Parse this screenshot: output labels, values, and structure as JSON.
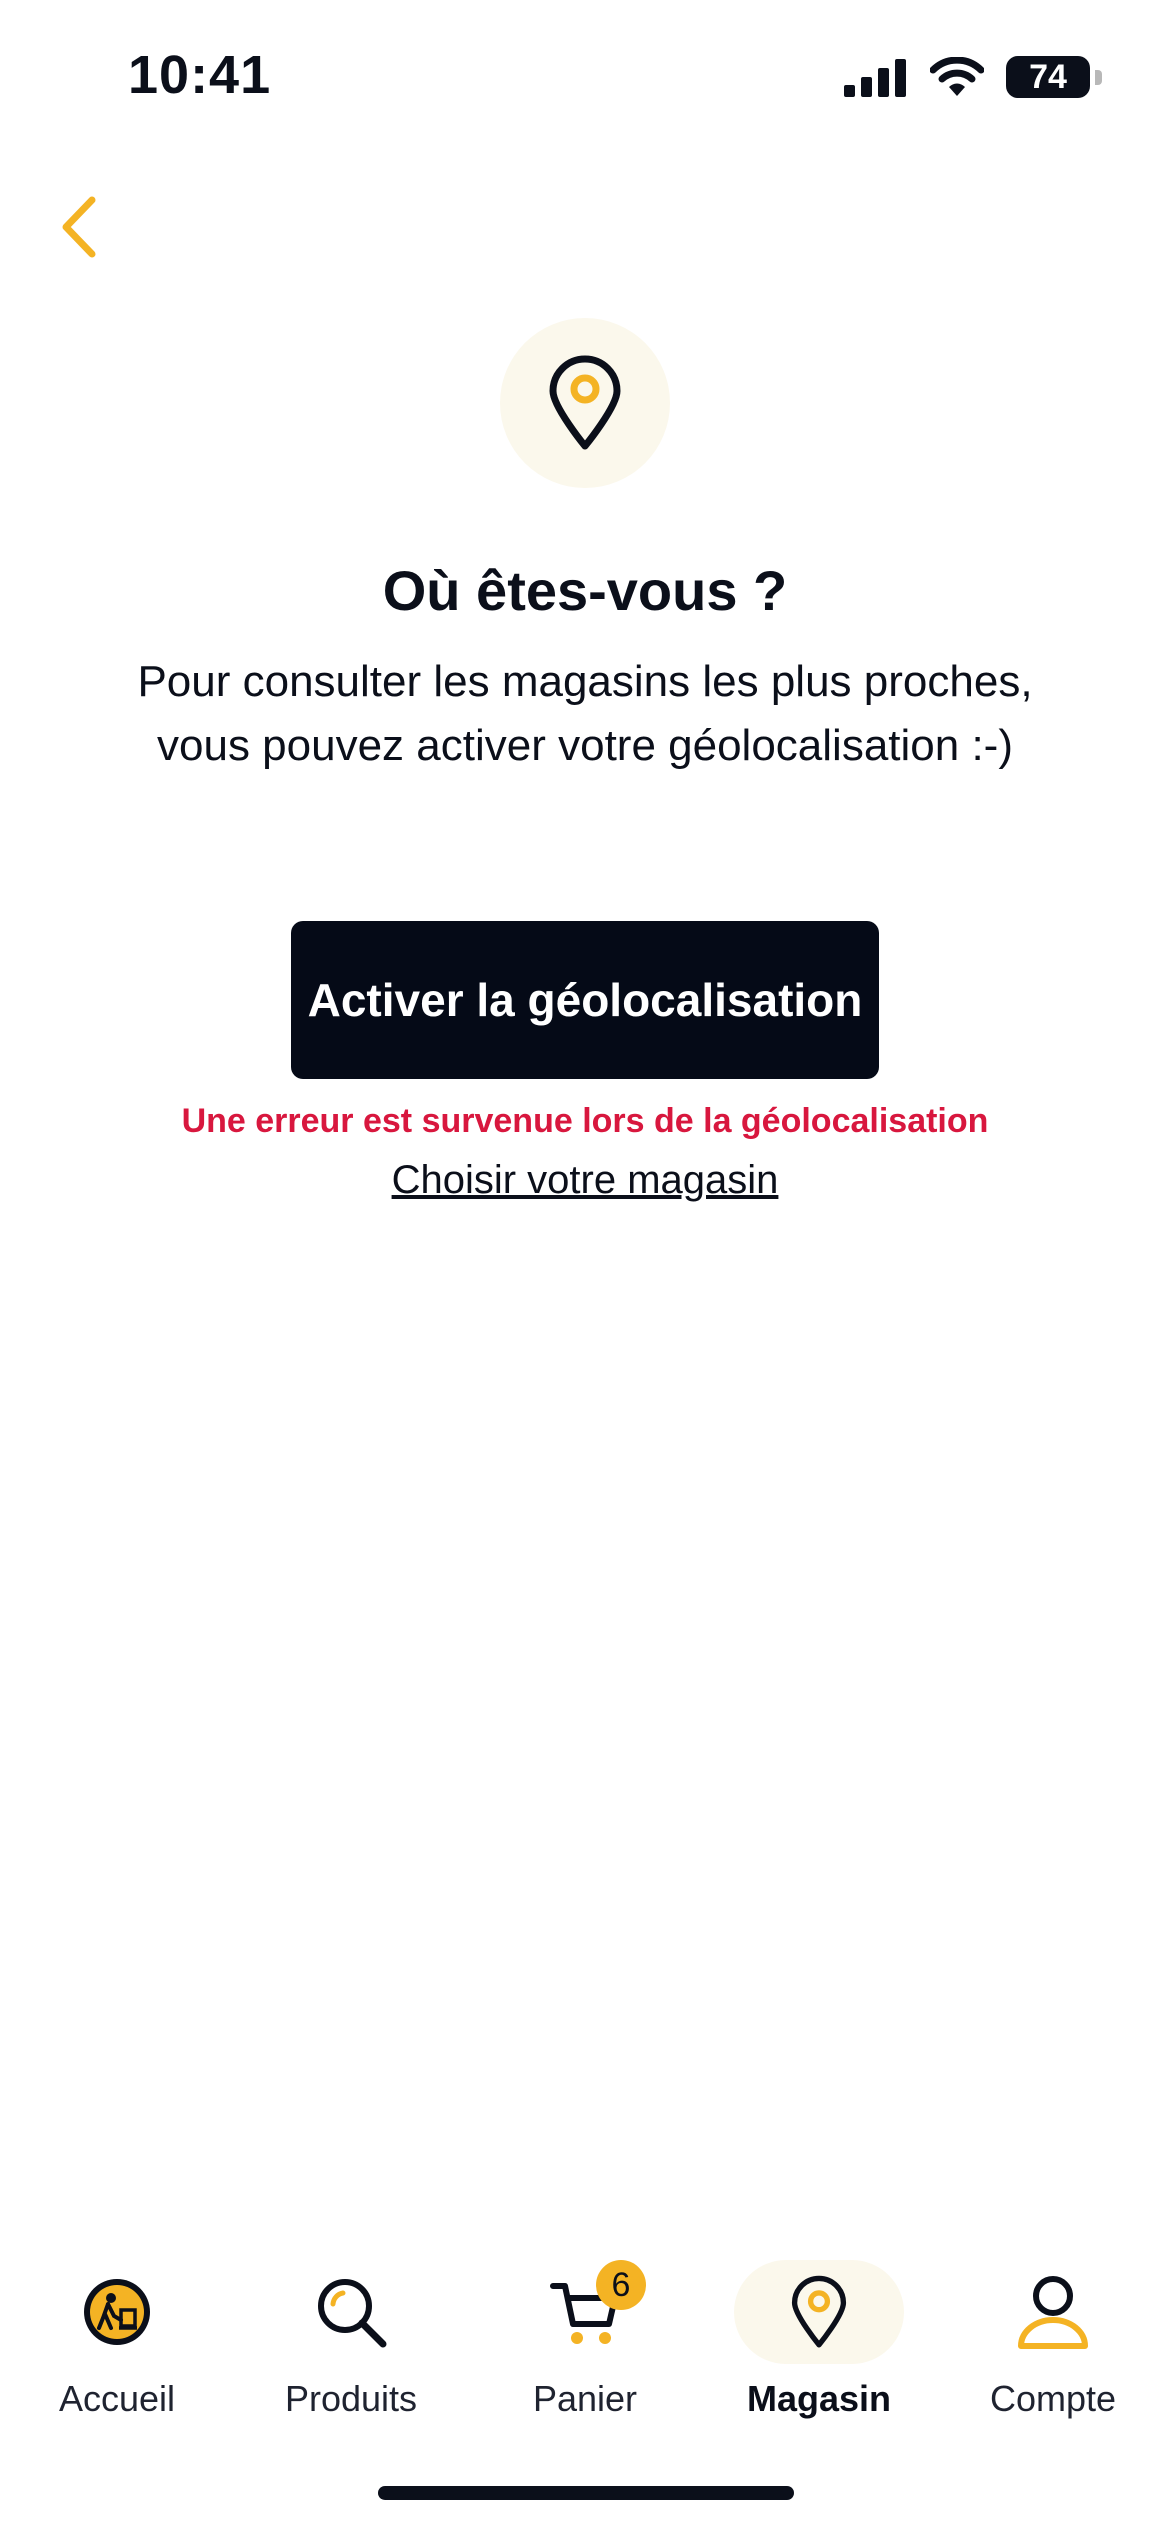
{
  "status_bar": {
    "time": "10:41",
    "battery": "74",
    "icons": [
      "cellular-signal-icon",
      "wifi-icon",
      "battery-icon"
    ]
  },
  "header": {
    "back_icon": "chevron-left-icon"
  },
  "hero": {
    "icon": "location-pin-icon"
  },
  "content": {
    "title": "Où êtes-vous ?",
    "subtitle_line1": "Pour consulter les magasins les plus proches,",
    "subtitle_line2": "vous pouvez activer votre géolocalisation :-)",
    "primary_button": "Activer la géolocalisation",
    "error_message": "Une erreur est survenue lors de la géolocalisation",
    "secondary_link": "Choisir votre magasin"
  },
  "tabs": [
    {
      "label": "Accueil",
      "icon": "home-logo-icon",
      "active": false
    },
    {
      "label": "Produits",
      "icon": "search-icon",
      "active": false
    },
    {
      "label": "Panier",
      "icon": "cart-icon",
      "active": false,
      "badge": "6"
    },
    {
      "label": "Magasin",
      "icon": "location-pin-icon",
      "active": true
    },
    {
      "label": "Compte",
      "icon": "user-icon",
      "active": false
    }
  ],
  "colors": {
    "accent": "#f4b324",
    "primary_dark": "#050a17",
    "error": "#d8173e",
    "hero_bg": "#fbf8ec"
  }
}
